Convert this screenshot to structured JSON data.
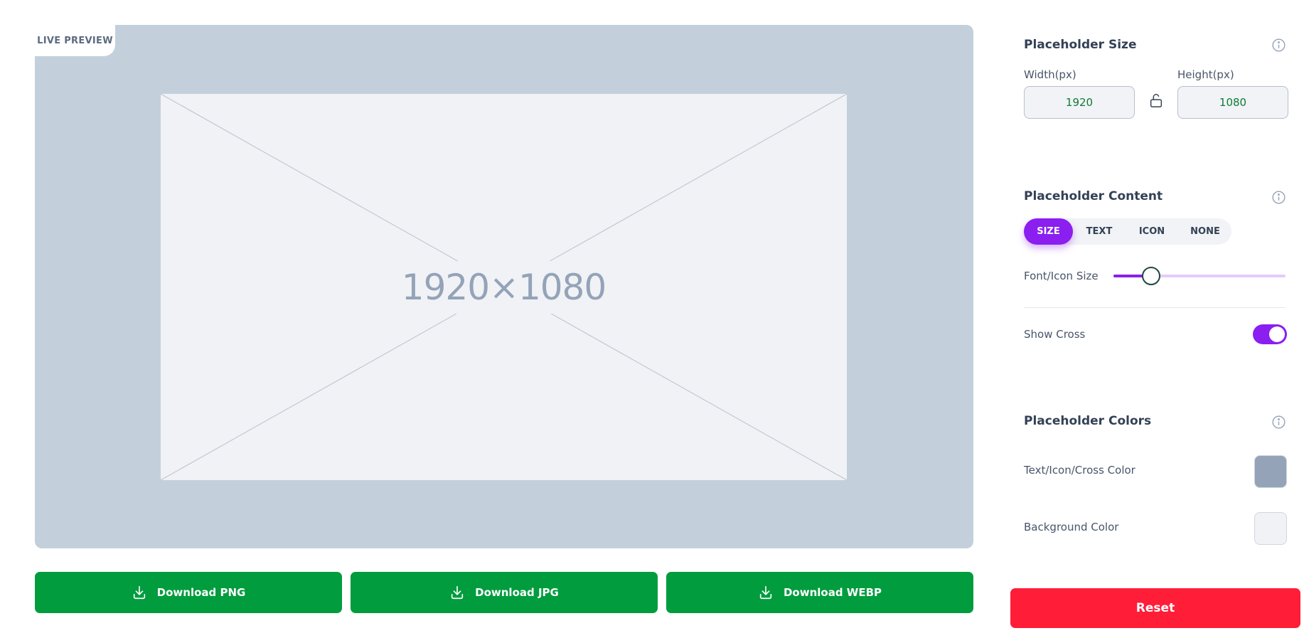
{
  "preview": {
    "tab_label": "LIVE PREVIEW",
    "placeholder_text": "1920×1080",
    "background_color": "#c3d0dc",
    "canvas_color": "#f0f2f6"
  },
  "downloads": {
    "png_label": "Download PNG",
    "jpg_label": "Download JPG",
    "webp_label": "Download WEBP",
    "color": "#009c3d"
  },
  "size_section": {
    "title": "Placeholder Size",
    "width_label": "Width(px)",
    "height_label": "Height(px)",
    "width_value": "1920",
    "height_value": "1080",
    "lock_icon": "unlocked-padlock-icon"
  },
  "content_section": {
    "title": "Placeholder Content",
    "options": [
      "SIZE",
      "TEXT",
      "ICON",
      "NONE"
    ],
    "selected": "SIZE",
    "font_size_label": "Font/Icon Size",
    "font_size_slider_fraction": 0.22,
    "show_cross_label": "Show Cross",
    "show_cross_on": true,
    "accent_color": "#8a1ff0"
  },
  "colors_section": {
    "title": "Placeholder Colors",
    "text_color_label": "Text/Icon/Cross Color",
    "text_color": "#94a3b8",
    "background_color_label": "Background Color",
    "background_color": "#f0f2f6"
  },
  "reset": {
    "label": "Reset",
    "color": "#ff1d38"
  }
}
